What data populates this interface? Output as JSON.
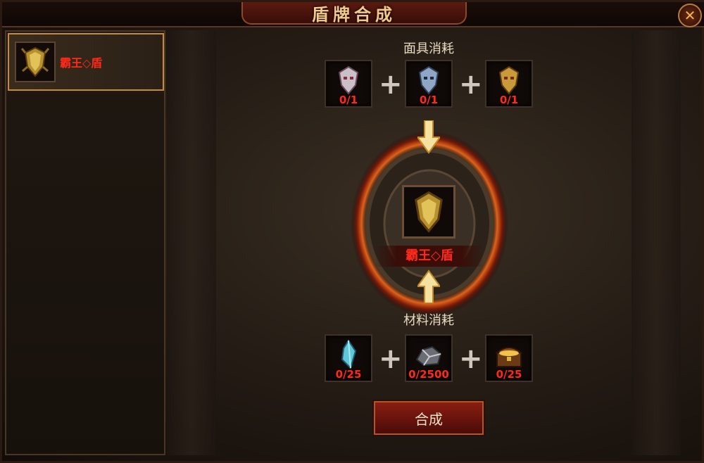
{
  "window": {
    "title": "盾牌合成"
  },
  "sidebar": {
    "items": [
      {
        "label": "霸王◇盾",
        "icon": "shield-icon"
      }
    ]
  },
  "mask_cost": {
    "label": "面具消耗",
    "slots": [
      {
        "icon": "silver-mask-icon",
        "count": "0/1"
      },
      {
        "icon": "blue-mask-icon",
        "count": "0/1"
      },
      {
        "icon": "gold-mask-icon",
        "count": "0/1"
      }
    ]
  },
  "result": {
    "label": "霸王◇盾",
    "icon": "shield-icon"
  },
  "material_cost": {
    "label": "材料消耗",
    "slots": [
      {
        "icon": "crystal-icon",
        "count": "0/25"
      },
      {
        "icon": "ore-icon",
        "count": "0/2500"
      },
      {
        "icon": "treasure-chest-icon",
        "count": "0/25"
      }
    ]
  },
  "actions": {
    "synthesize_label": "合成"
  },
  "colors": {
    "accent_red": "#ff2a1a",
    "gold": "#f2c98a",
    "fire": "#e0631a"
  }
}
